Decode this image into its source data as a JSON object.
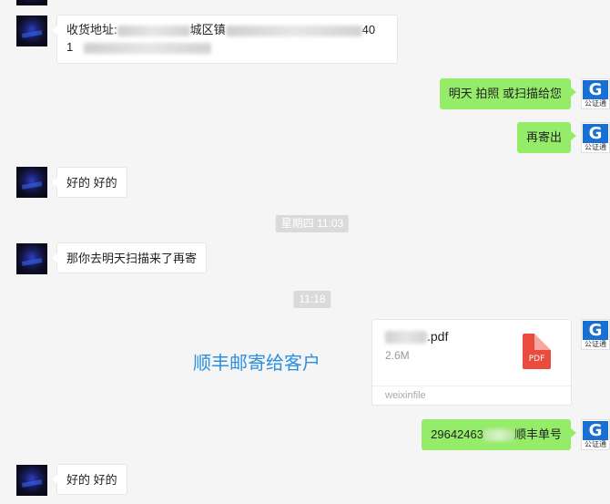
{
  "messages": [
    {
      "id": "m1",
      "side": "left",
      "line1_prefix": "收货地址:",
      "line1_mid": "城区镇",
      "line1_tail": "40",
      "line2_prefix": "1"
    },
    {
      "id": "m2",
      "side": "right",
      "text": "明天 拍照 或扫描给您"
    },
    {
      "id": "m3",
      "side": "right",
      "text": "再寄出"
    },
    {
      "id": "m4",
      "side": "left",
      "text": "好的 好的"
    },
    {
      "id": "m5",
      "side": "left",
      "text": "那你去明天扫描来了再寄"
    },
    {
      "id": "m6",
      "side": "right",
      "type": "file",
      "file_name_suffix": ".pdf",
      "file_size": "2.6M",
      "file_icon_label": "PDF",
      "source": "weixinfile"
    },
    {
      "id": "m7",
      "side": "right",
      "text_prefix": "29642463",
      "text_suffix": "顺丰单号"
    },
    {
      "id": "m8",
      "side": "left",
      "text": "好的 好的"
    }
  ],
  "timestamps": {
    "t1": "星期四 11:03",
    "t2": "11:18"
  },
  "annotation": {
    "text": "顺丰邮寄给客户",
    "color": "#2a8fe0"
  },
  "contact_avatar": {
    "icon": "contact-avatar"
  },
  "self_avatar": {
    "letter": "G",
    "caption": "公证通",
    "color": "#1a6fd2"
  },
  "colors": {
    "outgoing_bubble": "#95ec69",
    "incoming_bubble": "#ffffff",
    "background": "#f5f5f5"
  }
}
